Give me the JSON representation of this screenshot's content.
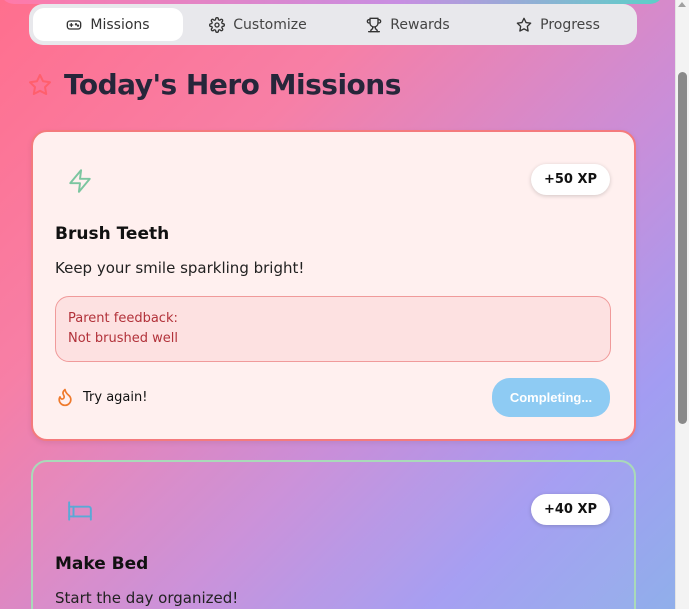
{
  "tabs": [
    {
      "label": "Missions",
      "icon": "gamepad-icon",
      "active": true
    },
    {
      "label": "Customize",
      "icon": "gear-icon",
      "active": false
    },
    {
      "label": "Rewards",
      "icon": "trophy-icon",
      "active": false
    },
    {
      "label": "Progress",
      "icon": "star-icon",
      "active": false
    }
  ],
  "page": {
    "title": "Today's Hero Missions",
    "title_icon": "star-outline-icon"
  },
  "missions": [
    {
      "icon": "lightning-icon",
      "xp": "+50 XP",
      "title": "Brush Teeth",
      "description": "Keep your smile sparkling bright!",
      "feedback_label": "Parent feedback:",
      "feedback_text": "Not brushed well",
      "status_icon": "flame-icon",
      "status_text": "Try again!",
      "button_label": "Completing..."
    },
    {
      "icon": "bed-icon",
      "xp": "+40 XP",
      "title": "Make Bed",
      "description": "Start the day organized!"
    }
  ],
  "colors": {
    "accent_red": "#f47a7d",
    "accent_green": "#a9d9b9",
    "button_blue": "#8ecbf3",
    "feedback_text": "#b2323a"
  }
}
